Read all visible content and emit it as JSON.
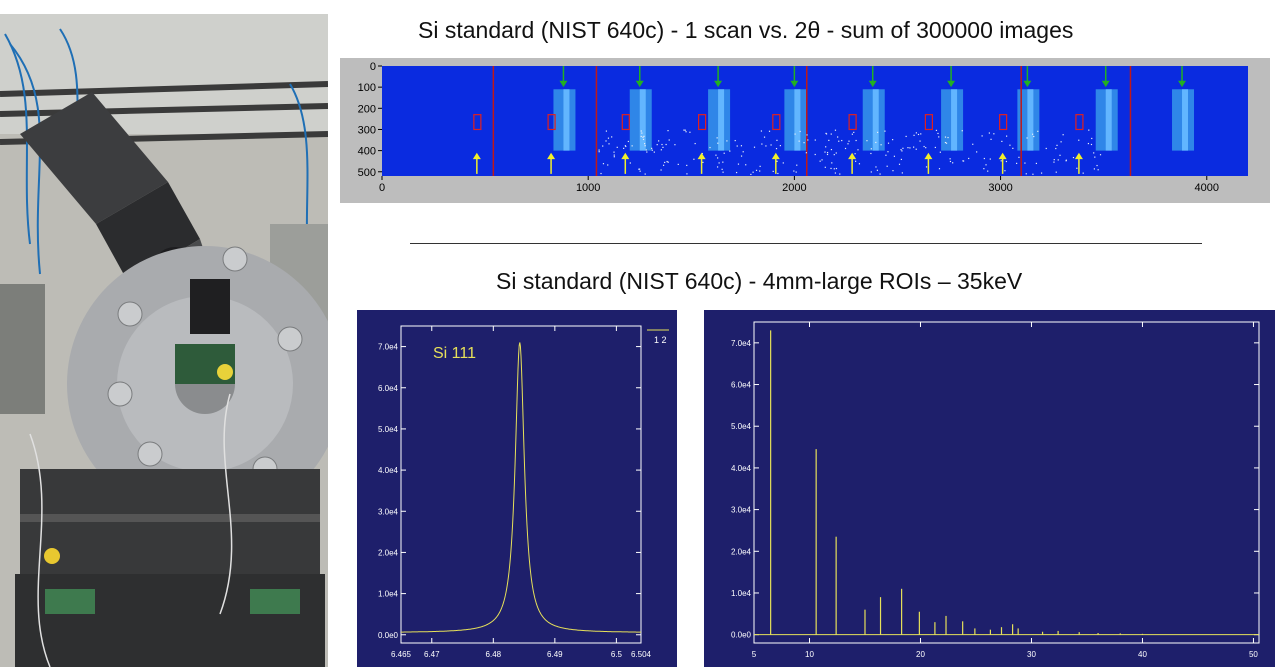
{
  "titles": {
    "top": "Si standard (NIST 640c) - 1 scan vs. 2θ - sum of 300000 images",
    "middle": "Si standard (NIST 640c) - 4mm-large ROIs – 35keV"
  },
  "colors": {
    "plot_bg": "#1e1f6b",
    "trace": "#e6e05a",
    "detector_bg": "#0a2be0",
    "green_arrow": "#22b022",
    "yellow_arrow": "#f2ef2a",
    "roi_box": "#e02020"
  },
  "detector_image": {
    "x_ticks": [
      "0",
      "1000",
      "2000",
      "3000",
      "4000"
    ],
    "y_ticks": [
      "0",
      "100",
      "200",
      "300",
      "400",
      "500"
    ]
  },
  "chart_data": [
    {
      "type": "line",
      "annotation": "Si 111",
      "legend": "1 2",
      "x_ticks": [
        "6.465",
        "6.47",
        "6.48",
        "6.49",
        "6.5",
        "6.504"
      ],
      "y_ticks": [
        "0.0e0",
        "1.0e4",
        "2.0e4",
        "3.0e4",
        "4.0e4",
        "5.0e4",
        "6.0e4",
        "7.0e4"
      ],
      "xlim": [
        6.465,
        6.504
      ],
      "ylim": [
        -2000,
        75000
      ],
      "peak": {
        "center": 6.4843,
        "height": 71000,
        "hwhm": 0.0009,
        "baseline": 500
      }
    },
    {
      "type": "line",
      "x_ticks": [
        "5",
        "10",
        "20",
        "30",
        "40",
        "50"
      ],
      "y_ticks": [
        "0.0e0",
        "1.0e4",
        "2.0e4",
        "3.0e4",
        "4.0e4",
        "5.0e4",
        "6.0e4",
        "7.0e4"
      ],
      "xlim": [
        5,
        50.5
      ],
      "ylim": [
        -2000,
        75000
      ],
      "x": [
        6.5,
        10.6,
        12.4,
        15.0,
        16.4,
        18.3,
        19.9,
        21.3,
        22.3,
        23.8,
        24.9,
        26.3,
        27.3,
        28.3,
        28.8,
        31.0,
        32.4,
        34.3,
        36.0,
        38.0,
        40.0
      ],
      "y": [
        73000,
        44500,
        23500,
        6000,
        9000,
        11000,
        5500,
        3000,
        4500,
        3200,
        1500,
        1200,
        1800,
        2500,
        1500,
        700,
        900,
        600,
        400,
        300,
        200
      ]
    }
  ]
}
